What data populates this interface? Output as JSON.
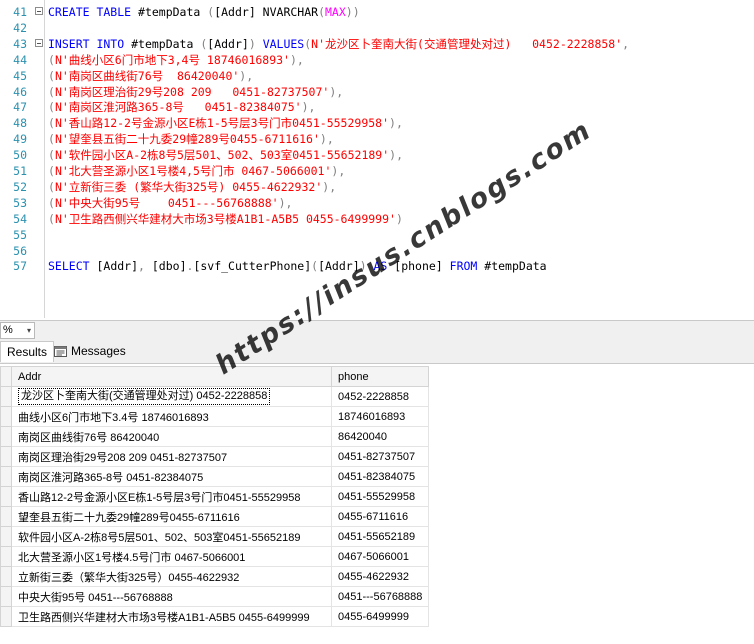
{
  "editor": {
    "lines": [
      {
        "num": "41",
        "fold": true,
        "parts": [
          [
            "kw",
            "CREATE TABLE "
          ],
          [
            "",
            "#tempData "
          ],
          [
            "gray",
            "("
          ],
          [
            "",
            "[Addr] NVARCHAR"
          ],
          [
            "gray",
            "("
          ],
          [
            "fn",
            "MAX"
          ],
          [
            "gray",
            "))"
          ]
        ]
      },
      {
        "num": "42",
        "fold": false,
        "parts": []
      },
      {
        "num": "43",
        "fold": true,
        "parts": [
          [
            "kw",
            "INSERT INTO "
          ],
          [
            "",
            "#tempData "
          ],
          [
            "gray",
            "("
          ],
          [
            "",
            "[Addr]"
          ],
          [
            "gray",
            ") "
          ],
          [
            "kw",
            "VALUES"
          ],
          [
            "gray",
            "("
          ],
          [
            "str",
            "N'龙沙区卜奎南大街(交通管理处对过)   0452-2228858'"
          ],
          [
            "gray",
            ",  "
          ]
        ]
      },
      {
        "num": "44",
        "fold": false,
        "parts": [
          [
            "gray",
            "("
          ],
          [
            "str",
            "N'曲线小区6门市地下3,4号 18746016893'"
          ],
          [
            "gray",
            "),"
          ]
        ]
      },
      {
        "num": "45",
        "fold": false,
        "parts": [
          [
            "gray",
            "("
          ],
          [
            "str",
            "N'南岗区曲线街76号  86420040'"
          ],
          [
            "gray",
            "),"
          ]
        ]
      },
      {
        "num": "46",
        "fold": false,
        "parts": [
          [
            "gray",
            "("
          ],
          [
            "str",
            "N'南岗区理治街29号208 209   0451-82737507'"
          ],
          [
            "gray",
            "),"
          ]
        ]
      },
      {
        "num": "47",
        "fold": false,
        "parts": [
          [
            "gray",
            "("
          ],
          [
            "str",
            "N'南岗区淮河路365-8号   0451-82384075'"
          ],
          [
            "gray",
            "),"
          ]
        ]
      },
      {
        "num": "48",
        "fold": false,
        "parts": [
          [
            "gray",
            "("
          ],
          [
            "str",
            "N'香山路12-2号金源小区E栋1-5号层3号门市0451-55529958'"
          ],
          [
            "gray",
            "),"
          ]
        ]
      },
      {
        "num": "49",
        "fold": false,
        "parts": [
          [
            "gray",
            "("
          ],
          [
            "str",
            "N'望奎县五街二十九委29幢289号0455-6711616'"
          ],
          [
            "gray",
            "),"
          ]
        ]
      },
      {
        "num": "50",
        "fold": false,
        "parts": [
          [
            "gray",
            "("
          ],
          [
            "str",
            "N'软件园小区A-2栋8号5层501、502、503室0451-55652189'"
          ],
          [
            "gray",
            "),"
          ]
        ]
      },
      {
        "num": "51",
        "fold": false,
        "parts": [
          [
            "gray",
            "("
          ],
          [
            "str",
            "N'北大营圣源小区1号楼4,5号门市 0467-5066001'"
          ],
          [
            "gray",
            "),"
          ]
        ]
      },
      {
        "num": "52",
        "fold": false,
        "parts": [
          [
            "gray",
            "("
          ],
          [
            "str",
            "N'立新街三委 (繁华大街325号) 0455-4622932'"
          ],
          [
            "gray",
            "),"
          ]
        ]
      },
      {
        "num": "53",
        "fold": false,
        "parts": [
          [
            "gray",
            "("
          ],
          [
            "str",
            "N'中央大街95号    0451---56768888'"
          ],
          [
            "gray",
            "),"
          ]
        ]
      },
      {
        "num": "54",
        "fold": false,
        "parts": [
          [
            "gray",
            "("
          ],
          [
            "str",
            "N'卫生路西侧兴华建材大市场3号楼A1B1-A5B5 0455-6499999'"
          ],
          [
            "gray",
            ")"
          ]
        ]
      },
      {
        "num": "55",
        "fold": false,
        "parts": []
      },
      {
        "num": "56",
        "fold": false,
        "parts": []
      },
      {
        "num": "57",
        "fold": false,
        "parts": [
          [
            "kw",
            "SELECT "
          ],
          [
            "",
            "[Addr]"
          ],
          [
            "gray",
            ", "
          ],
          [
            "",
            "[dbo]"
          ],
          [
            "gray",
            "."
          ],
          [
            "",
            "[svf_CutterPhone]"
          ],
          [
            "gray",
            "("
          ],
          [
            "",
            "[Addr]"
          ],
          [
            "gray",
            ") "
          ],
          [
            "kw",
            "AS "
          ],
          [
            "",
            "[phone] "
          ],
          [
            "kw",
            "FROM "
          ],
          [
            "",
            "#tempData"
          ]
        ]
      }
    ]
  },
  "zoom": {
    "value": "%",
    "arrow": "▾"
  },
  "tabs": {
    "results": "Results",
    "messages": "Messages"
  },
  "grid": {
    "columns": [
      "Addr",
      "phone"
    ],
    "rows": [
      [
        "龙沙区卜奎南大街(交通管理处对过)  0452-2228858",
        "0452-2228858"
      ],
      [
        "曲线小区6门市地下3.4号 18746016893",
        "18746016893"
      ],
      [
        "南岗区曲线街76号  86420040",
        "86420040"
      ],
      [
        "南岗区理治街29号208 209   0451-82737507",
        "0451-82737507"
      ],
      [
        "南岗区淮河路365-8号   0451-82384075",
        "0451-82384075"
      ],
      [
        "香山路12-2号金源小区E栋1-5号层3号门市0451-55529958",
        "0451-55529958"
      ],
      [
        "望奎县五街二十九委29幢289号0455-6711616",
        "0455-6711616"
      ],
      [
        "软件园小区A-2栋8号5层501、502、503室0451-55652189",
        "0451-55652189"
      ],
      [
        "北大营圣源小区1号楼4.5号门市 0467-5066001",
        "0467-5066001"
      ],
      [
        "立新街三委（繁华大街325号）0455-4622932",
        "0455-4622932"
      ],
      [
        "中央大街95号    0451---56768888",
        "0451---56768888"
      ],
      [
        "卫生路西侧兴华建材大市场3号楼A1B1-A5B5 0455-6499999",
        "0455-6499999"
      ]
    ]
  },
  "watermark": "https://insus.cnblogs.com"
}
